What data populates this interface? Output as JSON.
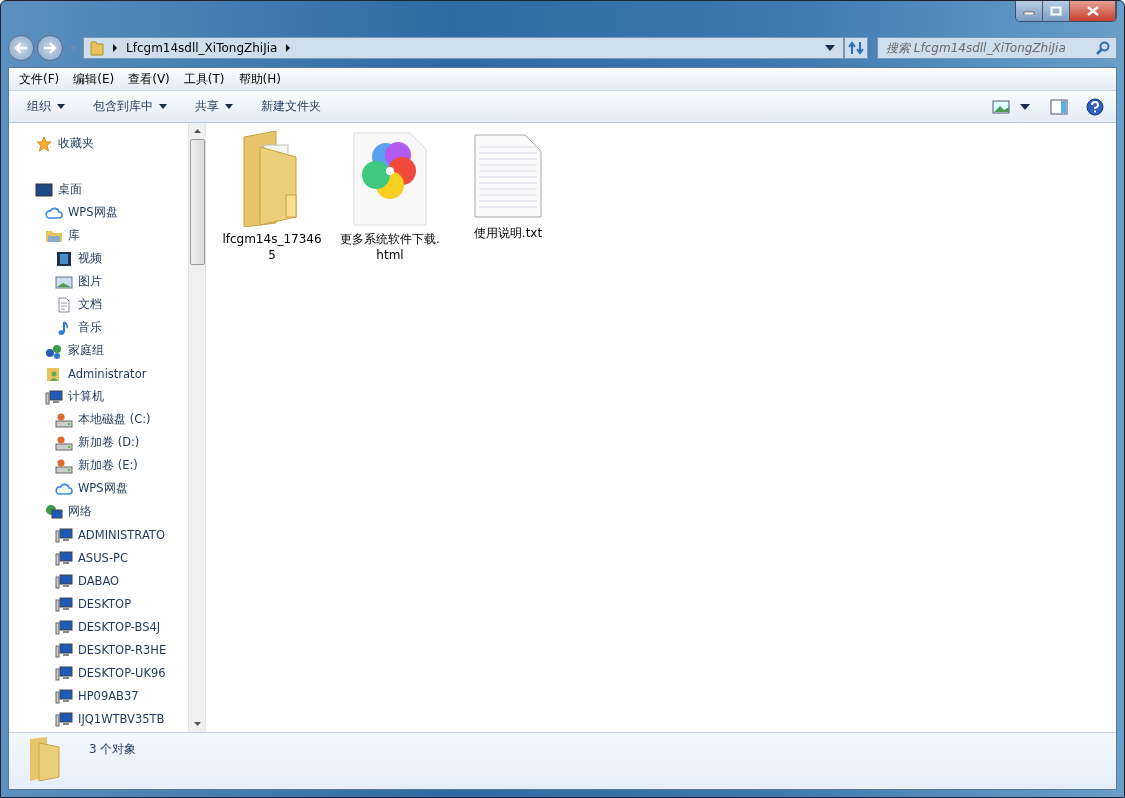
{
  "address": {
    "segments": [
      "Lfcgm14sdll_XiTongZhiJia"
    ]
  },
  "search": {
    "placeholder": "搜索 Lfcgm14sdll_XiTongZhiJia"
  },
  "menu": [
    "文件(F)",
    "编辑(E)",
    "查看(V)",
    "工具(T)",
    "帮助(H)"
  ],
  "toolbar": [
    {
      "label": "组织",
      "dropdown": true
    },
    {
      "label": "包含到库中",
      "dropdown": true
    },
    {
      "label": "共享",
      "dropdown": true
    },
    {
      "label": "新建文件夹",
      "dropdown": false
    }
  ],
  "sidebar": [
    {
      "label": "收藏夹",
      "kind": "star"
    },
    {
      "label": "桌面",
      "kind": "desktop",
      "children": [
        {
          "label": "WPS网盘",
          "kind": "cloud"
        },
        {
          "label": "库",
          "kind": "library",
          "children": [
            {
              "label": "视频",
              "kind": "video"
            },
            {
              "label": "图片",
              "kind": "picture"
            },
            {
              "label": "文档",
              "kind": "document"
            },
            {
              "label": "音乐",
              "kind": "music"
            }
          ]
        },
        {
          "label": "家庭组",
          "kind": "homegroup"
        },
        {
          "label": "Administrator",
          "kind": "user"
        },
        {
          "label": "计算机",
          "kind": "computer",
          "children": [
            {
              "label": "本地磁盘 (C:)",
              "kind": "drive"
            },
            {
              "label": "新加卷 (D:)",
              "kind": "drive"
            },
            {
              "label": "新加卷 (E:)",
              "kind": "drive"
            },
            {
              "label": "WPS网盘",
              "kind": "cloud"
            }
          ]
        },
        {
          "label": "网络",
          "kind": "network",
          "children": [
            {
              "label": "ADMINISTRATO",
              "kind": "pc"
            },
            {
              "label": "ASUS-PC",
              "kind": "pc"
            },
            {
              "label": "DABAO",
              "kind": "pc"
            },
            {
              "label": "DESKTOP",
              "kind": "pc"
            },
            {
              "label": "DESKTOP-BS4J",
              "kind": "pc"
            },
            {
              "label": "DESKTOP-R3HE",
              "kind": "pc"
            },
            {
              "label": "DESKTOP-UK96",
              "kind": "pc"
            },
            {
              "label": "HP09AB37",
              "kind": "pc"
            },
            {
              "label": "IJQ1WTBV35TB",
              "kind": "pc"
            }
          ]
        }
      ]
    }
  ],
  "files": [
    {
      "name": "lfcgm14s_173465",
      "kind": "folder"
    },
    {
      "name": "更多系统软件下载.html",
      "kind": "html"
    },
    {
      "name": "使用说明.txt",
      "kind": "text"
    }
  ],
  "status_bar": {
    "count": "3 个对象"
  }
}
